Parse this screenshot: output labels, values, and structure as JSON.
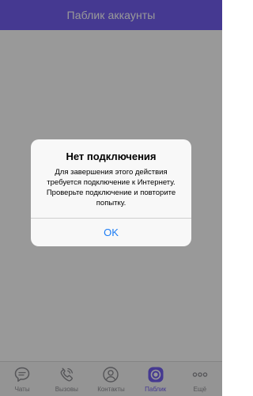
{
  "header": {
    "title": "Паблик аккаунты"
  },
  "tabs": [
    {
      "label": "Чаты",
      "icon": "chat-bubble-icon",
      "active": false
    },
    {
      "label": "Вызовы",
      "icon": "phone-icon",
      "active": false
    },
    {
      "label": "Контакты",
      "icon": "contact-icon",
      "active": false
    },
    {
      "label": "Паблик",
      "icon": "public-accounts-icon",
      "active": true
    },
    {
      "label": "Ещё",
      "icon": "more-dots-icon",
      "active": false
    }
  ],
  "alert": {
    "title": "Нет подключения",
    "message": "Для завершения этого действия требуется подключение к Интернету. Проверьте подключение и повторите попытку.",
    "button_label": "OK"
  },
  "colors": {
    "accent": "#7360f2",
    "link_blue": "#1b7cf5",
    "inactive_gray": "#8e8e93"
  }
}
